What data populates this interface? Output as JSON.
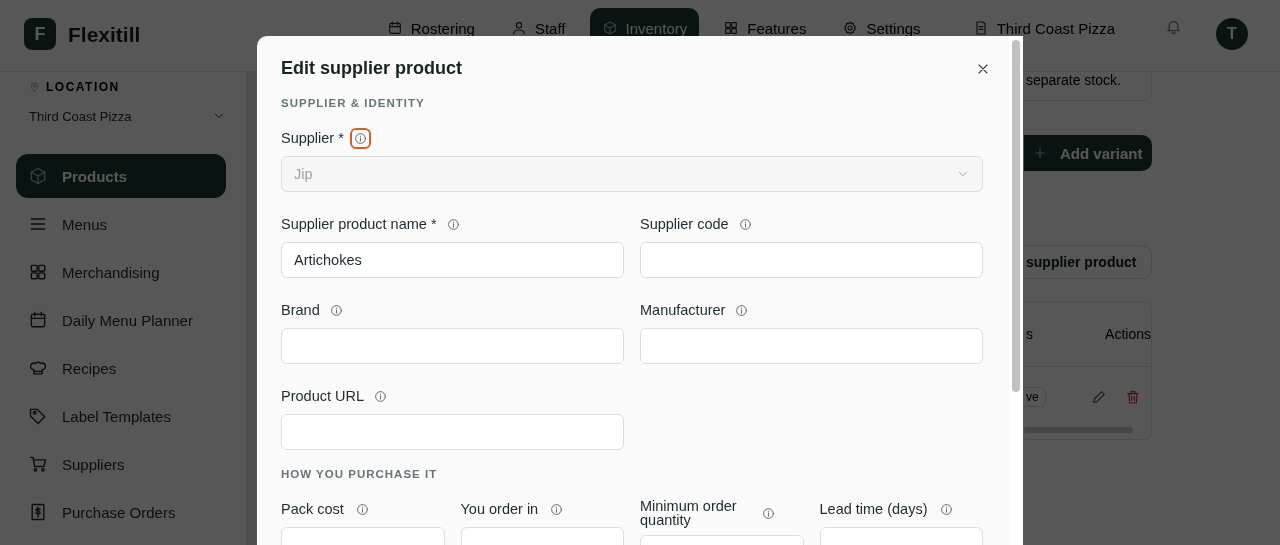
{
  "app": {
    "logo_letter": "F",
    "name": "Flexitill"
  },
  "top_nav": [
    {
      "label": "Rostering",
      "selected": false
    },
    {
      "label": "Staff",
      "selected": false
    },
    {
      "label": "Inventory",
      "selected": true
    },
    {
      "label": "Features",
      "selected": false
    },
    {
      "label": "Settings",
      "selected": false
    }
  ],
  "venue": "Third Coast Pizza",
  "avatar": "T",
  "sidebar": {
    "location_label": "LOCATION",
    "location": "Third Coast Pizza",
    "items": [
      {
        "label": "Products",
        "selected": true
      },
      {
        "label": "Menus",
        "selected": false
      },
      {
        "label": "Merchandising",
        "selected": false
      },
      {
        "label": "Daily Menu Planner",
        "selected": false
      },
      {
        "label": "Recipes",
        "selected": false
      },
      {
        "label": "Label Templates",
        "selected": false
      },
      {
        "label": "Suppliers",
        "selected": false
      },
      {
        "label": "Purchase Orders",
        "selected": false
      }
    ]
  },
  "background": {
    "note": "separate stock.",
    "add_button": "Add variant",
    "supplier_button": "supplier product",
    "table_columns": [
      "s",
      "Actions"
    ],
    "status_fragment": "ve"
  },
  "modal": {
    "title": "Edit supplier product",
    "sections": [
      {
        "heading": "SUPPLIER & IDENTITY",
        "rows": [
          [
            {
              "label": "Supplier *",
              "kind": "select",
              "value": "Jip",
              "disabled": true,
              "info_focused": true
            }
          ],
          [
            {
              "label": "Supplier product name *",
              "kind": "text",
              "value": "Artichokes",
              "info_focused": false
            },
            {
              "label": "Supplier code",
              "kind": "text",
              "info_focused": false
            }
          ],
          [
            {
              "label": "Brand",
              "kind": "text",
              "info_focused": false
            },
            {
              "label": "Manufacturer",
              "kind": "text",
              "info_focused": false
            }
          ],
          [
            {
              "label": "Product URL",
              "kind": "text",
              "info_focused": false
            }
          ]
        ]
      },
      {
        "heading": "HOW YOU PURCHASE IT",
        "rows": [
          [
            {
              "label": "Pack cost",
              "kind": "text",
              "info_focused": false
            },
            {
              "label": "You order in",
              "kind": "text",
              "info_focused": false
            },
            {
              "label": "Minimum order quantity",
              "kind": "text",
              "info_focused": false
            },
            {
              "label": "Lead time (days)",
              "kind": "text",
              "info_focused": false
            }
          ]
        ]
      }
    ]
  }
}
